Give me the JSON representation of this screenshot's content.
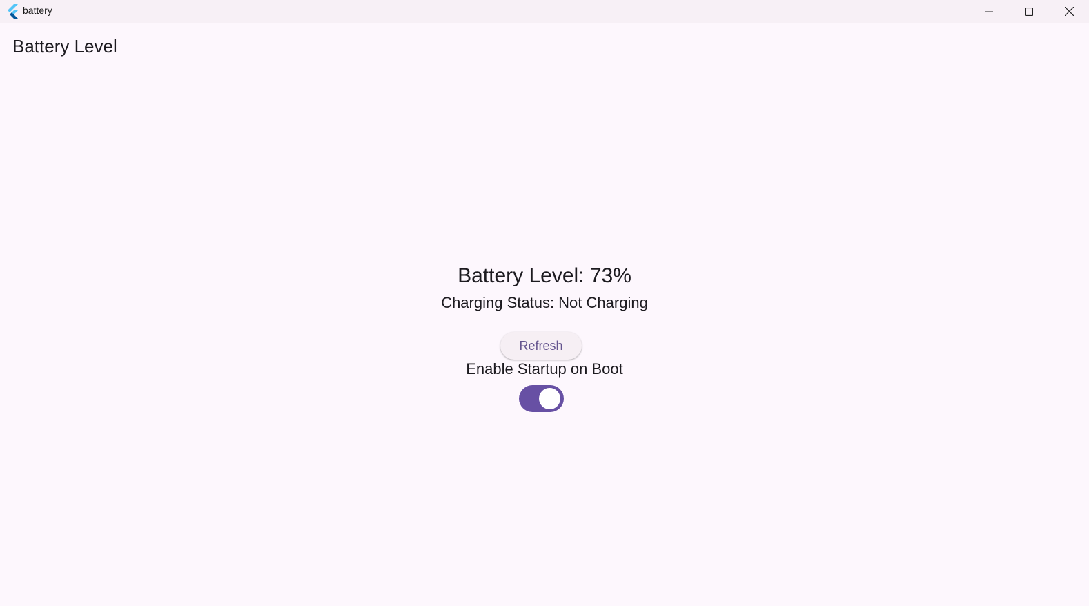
{
  "window": {
    "title": "battery",
    "app_icon": "flutter-logo-icon",
    "controls": [
      "minimize-icon",
      "maximize-icon",
      "close-icon"
    ]
  },
  "appbar": {
    "title": "Battery Level"
  },
  "main": {
    "battery_level": "Battery Level: 73%",
    "charging_status": "Charging Status: Not Charging",
    "refresh_label": "Refresh",
    "startup_label": "Enable Startup on Boot",
    "startup_toggle_on": true
  },
  "colors": {
    "background": "#fdf7fd",
    "titlebar": "#f7f0f6",
    "accent": "#6750a4",
    "button_text": "#65558f"
  }
}
